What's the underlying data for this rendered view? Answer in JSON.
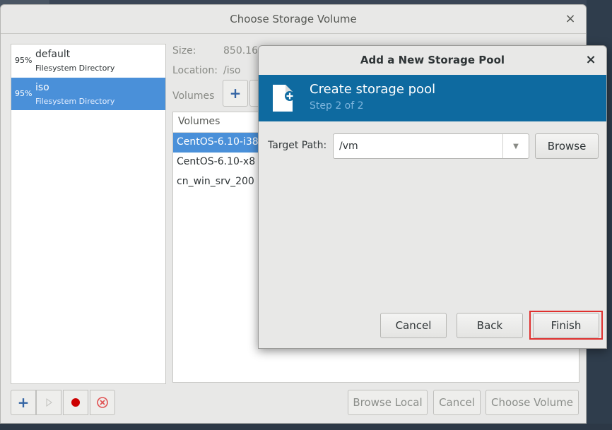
{
  "back_window": {
    "title": "Choose Storage Volume",
    "close_glyph": "×",
    "pools": [
      {
        "percent": "95%",
        "name": "default",
        "type": "Filesystem Directory",
        "selected": false
      },
      {
        "percent": "95%",
        "name": "iso",
        "type": "Filesystem Directory",
        "selected": true
      }
    ],
    "size_label": "Size:",
    "size_value": "850.16",
    "location_label": "Location:",
    "location_value": "/iso",
    "volumes_label": "Volumes",
    "volumes_column_header": "Volumes",
    "volumes": [
      {
        "name": "CentOS-6.10-i38",
        "selected": true
      },
      {
        "name": "CentOS-6.10-x8",
        "selected": false
      },
      {
        "name": "cn_win_srv_200",
        "selected": false
      }
    ],
    "buttons": {
      "browse_local": "Browse Local",
      "cancel": "Cancel",
      "choose_volume": "Choose Volume"
    }
  },
  "dialog": {
    "title": "Add a New Storage Pool",
    "close_glyph": "×",
    "heading": "Create storage pool",
    "step": "Step 2 of 2",
    "target_path_label": "Target Path:",
    "target_path_value": "/vm",
    "browse": "Browse",
    "cancel": "Cancel",
    "back": "Back",
    "finish": "Finish"
  },
  "colors": {
    "accent": "#0e6aa0",
    "selection": "#4a90d9",
    "highlight": "#e0302e"
  },
  "icons": {
    "add": "plus-icon",
    "start": "play-icon",
    "stop": "record-icon",
    "delete": "delete-icon",
    "new_file": "new-file-icon",
    "dropdown": "chevron-down-icon"
  }
}
